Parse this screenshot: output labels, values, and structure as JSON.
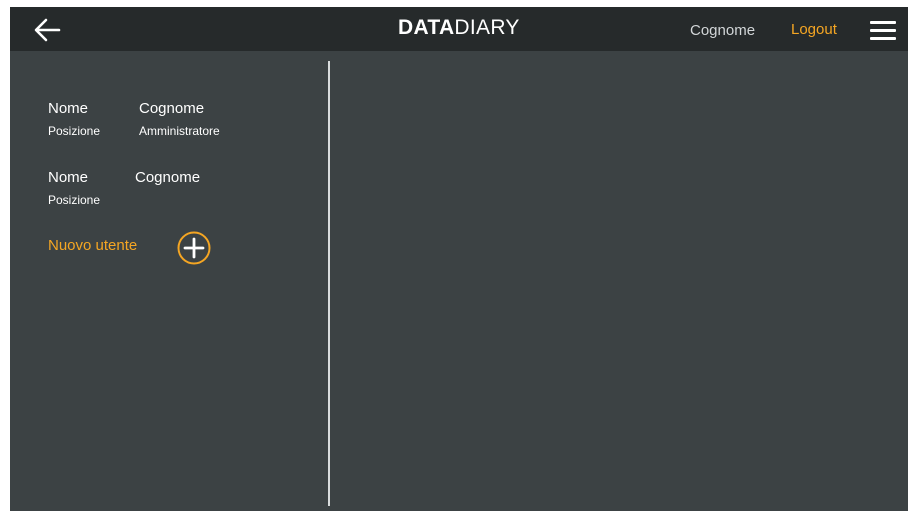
{
  "header": {
    "logo": {
      "bold": "DATA",
      "light": "DIARY"
    },
    "user_name": "Cognome",
    "logout_label": "Logout"
  },
  "sidebar": {
    "users": [
      {
        "first": "Nome",
        "last": "Cognome",
        "position": "Posizione",
        "role": "Amministratore"
      },
      {
        "first": "Nome",
        "last": "Cognome",
        "position": "Posizione",
        "role": ""
      }
    ],
    "new_user_label": "Nuovo utente"
  },
  "icons": {
    "back": "arrow-left-icon",
    "menu": "hamburger-menu-icon",
    "add": "plus-circle-icon"
  },
  "colors": {
    "accent": "#f5a623",
    "header_bg": "#262a2b",
    "panel_bg": "#3c4244",
    "text": "#ffffff"
  }
}
